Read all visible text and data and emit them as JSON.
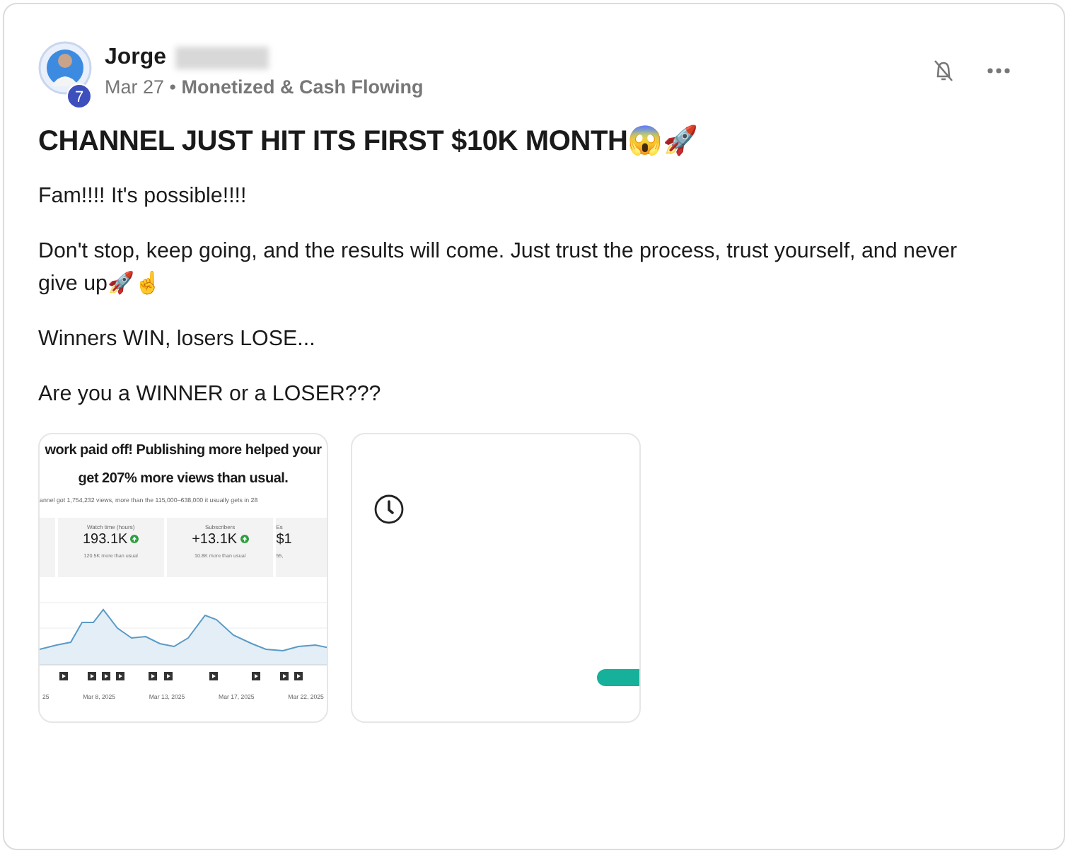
{
  "post": {
    "author": {
      "name": "Jorge",
      "rank_badge": "7",
      "name_redacted": true
    },
    "date": "Mar 27",
    "separator": "•",
    "category": "Monetized & Cash Flowing",
    "title": "CHANNEL JUST HIT ITS FIRST $10K MONTH😱🚀",
    "paragraphs": [
      "Fam!!!! It's possible!!!!",
      "Don't stop, keep going, and the results will come. Just trust the process, trust yourself, and never give up🚀☝",
      "Winners WIN, losers LOSE...",
      "Are you a WINNER or a LOSER???"
    ]
  },
  "attachments": [
    {
      "kind": "screenshot",
      "headline": [
        "work paid off! Publishing more helped your",
        "get 207% more views than usual."
      ],
      "summary": "annel got 1,754,232 views, more than the 115,000–638,000 it usually gets in 28",
      "stats": [
        {
          "label": "Watch time (hours)",
          "value": "193.1K",
          "note": "120.5K more than usual",
          "up": true
        },
        {
          "label": "Subscribers",
          "value": "+13.1K",
          "note": "10.8K more than usual",
          "up": true
        },
        {
          "label": "Es",
          "value": "$1",
          "note": "55,",
          "up": false
        }
      ],
      "dates": [
        "25",
        "Mar 8, 2025",
        "Mar 13, 2025",
        "Mar 17, 2025",
        "Mar 22, 2025"
      ]
    },
    {
      "kind": "loading"
    }
  ]
}
